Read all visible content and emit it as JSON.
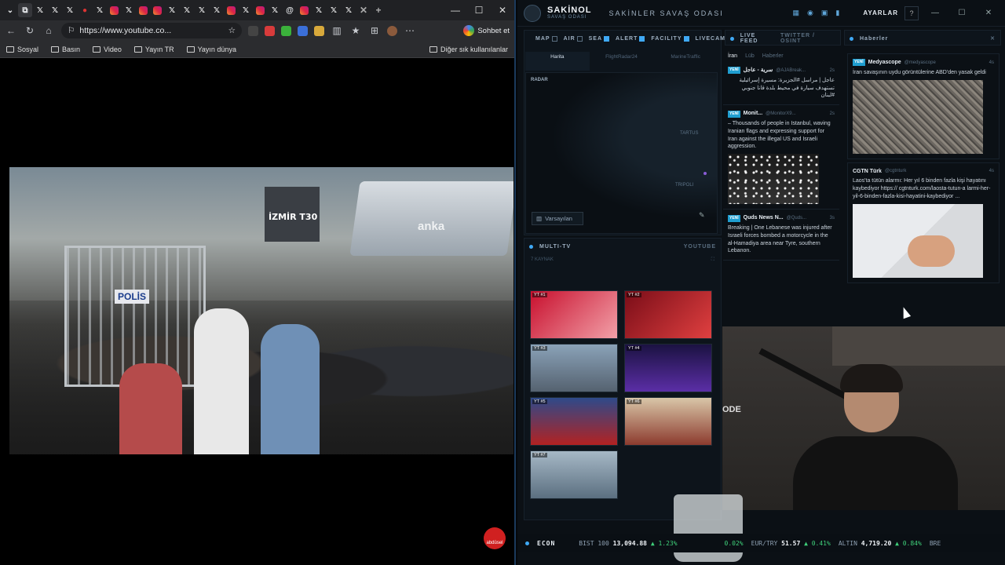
{
  "browser": {
    "url": "https://www.youtube.co...",
    "chat_label": "Sohbet et",
    "bookmarks": [
      "Sosyal",
      "Basın",
      "Video",
      "Yayın TR",
      "Yayın dünya"
    ],
    "bookmarks_other": "Diğer sık kullanılanlar",
    "video_overlay": {
      "truck_label": "İZMİR T30",
      "polis": "POLİS",
      "anka": "anka"
    },
    "channel_logo_text": "abdüsel"
  },
  "dashboard": {
    "brand": "SAKİNOL",
    "brand_sub": "SAVAŞ ODASI",
    "title": "SAKİNLER SAVAŞ ODASI",
    "settings": "AYARLAR",
    "help": "?",
    "map_layers": [
      {
        "label": "MAP",
        "on": false
      },
      {
        "label": "AIR",
        "on": false
      },
      {
        "label": "SEA",
        "on": false
      },
      {
        "label": "ALERT",
        "on": true
      },
      {
        "label": "FACILITY",
        "on": true
      },
      {
        "label": "LIVECAM",
        "on": true
      }
    ],
    "map_tabs": [
      "Harita",
      "FlightRadar24",
      "MarineTraffic"
    ],
    "radar_label": "RADAR",
    "map_places": [
      "TARTUS",
      "TRIPOLI"
    ],
    "map_default_btn": "Varsayılan",
    "multitv": {
      "title": "MULTI-TV",
      "source": "YOUTUBE",
      "count": "7 KAYNAK",
      "cells": [
        "YT #1",
        "YT #2",
        "YT #3",
        "YT #4",
        "YT #5",
        "YT #6",
        "YT #7"
      ]
    },
    "livefeed": {
      "title": "LIVE FEED",
      "subtitle": "TWITTER / OSINT",
      "filters": [
        "İran",
        "Lüb",
        "Haberler"
      ],
      "items": [
        {
          "badge": "YENİ",
          "source": "سرية - عاجل",
          "handle": "@AJABreak...",
          "time": "2s",
          "text": "عاجل | مراسل #الجزيرة: مسيرة إسرائيلية تستهدف سيارة في محيط بلدة قانا جنوبي #لبنان"
        },
        {
          "badge": "YENİ",
          "source": "Monit...",
          "handle": "@MonitorX9...",
          "time": "2s",
          "text": "– Thousands of people in Istanbul, waving Iranian flags and expressing support for Iran against the illegal US and Israeli aggression."
        },
        {
          "badge": "YENİ",
          "source": "Quds News N...",
          "handle": "@Quds...",
          "time": "3s",
          "text": "Breaking | One Lebanese was injured after Israeli forces bombed a motorcycle in the al-Hamadiya area near Tyre, southern Lebanon."
        }
      ]
    },
    "news": {
      "title": "Haberler",
      "items": [
        {
          "badge": "YENİ",
          "source": "Medyascope",
          "handle": "@medyascope",
          "time": "4s",
          "text": "İran savaşının uydu görüntülerine ABD'den yasak geldi"
        },
        {
          "badge": "",
          "source": "CGTN Türk",
          "handle": "@cgtnturk",
          "time": "4s",
          "text": "Laos'ta tütün alarmı: Her yıl 6 binden fazla kişi hayatını kaybediyor https:// cgtnturk.com/laosta-tutun-a larmi-her-yil-6-binden-fazla-kisi-hayatini-kaybediyor ..."
        }
      ]
    },
    "webcam_sign": "ODE",
    "ticker": {
      "label": "ECON",
      "items": [
        {
          "name": "BIST 100",
          "value": "13,094.88",
          "change": "▲ 1.23%"
        },
        {
          "name": "",
          "value": "",
          "change": "0.02%"
        },
        {
          "name": "EUR/TRY",
          "value": "51.57",
          "change": "▲ 0.41%"
        },
        {
          "name": "ALTIN",
          "value": "4,719.20",
          "change": "▲ 0.84%"
        },
        {
          "name": "BRE",
          "value": "",
          "change": ""
        }
      ]
    }
  },
  "colors": {
    "accent": "#3fa9f5",
    "up": "#3fd07a",
    "new_badge": "#1f9ed0"
  }
}
